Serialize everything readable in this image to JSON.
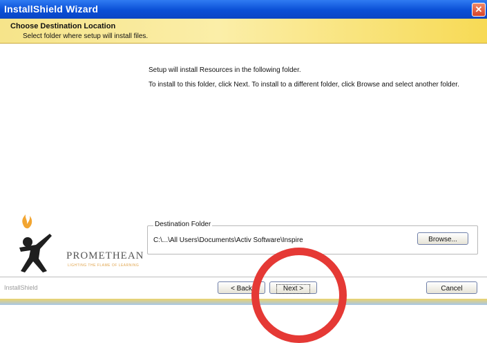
{
  "titlebar": {
    "title": "InstallShield Wizard",
    "close_symbol": "✕"
  },
  "header": {
    "title": "Choose Destination Location",
    "subtitle": "Select folder where setup will install files."
  },
  "content": {
    "line1": "Setup will install Resources in the following folder.",
    "line2": "To install to this folder, click Next.  To install to a different folder, click Browse and select another folder."
  },
  "logo": {
    "name": "PROMETHEAN",
    "tagline": "LIGHTING THE FLAME OF LEARNING"
  },
  "destination": {
    "label": "Destination Folder",
    "path": "C:\\...\\All Users\\Documents\\Activ Software\\Inspire",
    "browse_label": "Browse..."
  },
  "footer": {
    "brand": "InstallShield",
    "back_label": "< Back",
    "next_label": "Next >",
    "cancel_label": "Cancel"
  },
  "annotation": {
    "circle_color": "#e53935"
  },
  "colors": {
    "titlebar": "#0a4fd6",
    "header_band": "#f7da55",
    "logo_flame": "#f2a531"
  }
}
